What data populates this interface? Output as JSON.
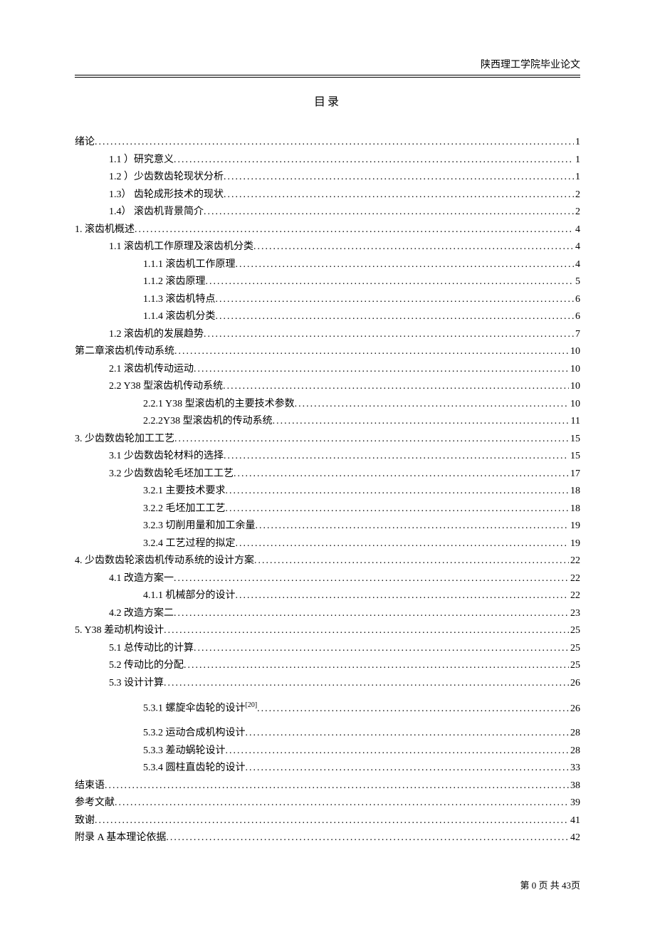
{
  "header": {
    "institution": "陕西理工学院毕业论文"
  },
  "title": "目录",
  "toc": [
    {
      "level": 0,
      "text": "绪论",
      "page": "1"
    },
    {
      "level": 1,
      "text": "1.1 ）研究意义",
      "page": "1"
    },
    {
      "level": 1,
      "text": "1.2 ）少齿数齿轮现状分析",
      "page": "1"
    },
    {
      "level": 1,
      "text": "1.3）  齿轮成形技术的现状",
      "page": "2"
    },
    {
      "level": 1,
      "text": "1.4）  滚齿机背景简介",
      "page": "2"
    },
    {
      "level": 0,
      "text": "1. 滚齿机概述",
      "page": "4"
    },
    {
      "level": 1,
      "text": "1.1 滚齿机工作原理及滚齿机分类",
      "page": "4"
    },
    {
      "level": 2,
      "text": "1.1.1 滚齿机工作原理",
      "page": "4"
    },
    {
      "level": 2,
      "text": "1.1.2 滚齿原理",
      "page": "5"
    },
    {
      "level": 2,
      "text": "1.1.3 滚齿机特点",
      "page": "6"
    },
    {
      "level": 2,
      "text": "1.1.4 滚齿机分类",
      "page": "6"
    },
    {
      "level": 1,
      "text": "1.2 滚齿机的发展趋势",
      "page": "7"
    },
    {
      "level": 0,
      "text": "第二章滚齿机传动系统",
      "page": "10"
    },
    {
      "level": 1,
      "text": "2.1 滚齿机传动运动",
      "page": "10"
    },
    {
      "level": 1,
      "text": "2.2 Y38 型滚齿机传动系统",
      "page": "10"
    },
    {
      "level": 2,
      "text": "2.2.1 Y38 型滚齿机的主要技术参数",
      "page": "10"
    },
    {
      "level": 2,
      "text": "2.2.2Y38 型滚齿机的传动系统",
      "page": "11"
    },
    {
      "level": 0,
      "text": "3. 少齿数齿轮加工工艺",
      "page": "15"
    },
    {
      "level": 1,
      "text": "3.1 少齿数齿轮材料的选择",
      "page": "15"
    },
    {
      "level": 1,
      "text": "3.2 少齿数齿轮毛坯加工工艺",
      "page": "17"
    },
    {
      "level": 2,
      "text": "3.2.1 主要技术要求",
      "page": "18"
    },
    {
      "level": 2,
      "text": "3.2.2 毛坯加工工艺",
      "page": "18"
    },
    {
      "level": 2,
      "text": "3.2.3 切削用量和加工余量",
      "page": "19"
    },
    {
      "level": 2,
      "text": "3.2.4 工艺过程的拟定",
      "page": "19"
    },
    {
      "level": 0,
      "text": "4. 少齿数齿轮滚齿机传动系统的设计方案",
      "page": "22"
    },
    {
      "level": 1,
      "text": "4.1 改造方案一",
      "page": "22"
    },
    {
      "level": 2,
      "text": "4.1.1 机械部分的设计",
      "page": "22"
    },
    {
      "level": 1,
      "text": "4.2 改造方案二",
      "page": "23"
    },
    {
      "level": 0,
      "text": "5. Y38 差动机构设计",
      "page": "25"
    },
    {
      "level": 1,
      "text": "5.1 总传动比的计算",
      "page": "25"
    },
    {
      "level": 1,
      "text": "5.2 传动比的分配",
      "page": "25"
    },
    {
      "level": 1,
      "text": "5.3 设计计算",
      "page": "26"
    },
    {
      "level": 2,
      "text": "5.3.1 螺旋伞齿轮的设计",
      "sup": "[20]",
      "page": "26",
      "spaced": true
    },
    {
      "level": 2,
      "text": "5.3.2 运动合成机构设计",
      "page": "28"
    },
    {
      "level": 2,
      "text": "5.3.3 差动蜗轮设计",
      "page": "28"
    },
    {
      "level": 2,
      "text": "5.3.4 圆柱直齿轮的设计",
      "page": "33"
    },
    {
      "level": 0,
      "text": "结束语",
      "page": "38"
    },
    {
      "level": 0,
      "text": "参考文献",
      "page": "39"
    },
    {
      "level": 0,
      "text": "致谢",
      "page": "41"
    },
    {
      "level": 0,
      "text": "附录 A   基本理论依据",
      "page": "42"
    }
  ],
  "footer": {
    "prefix": "第",
    "current": "0",
    "mid": "页 共",
    "total": "43",
    "suffix": "页"
  }
}
